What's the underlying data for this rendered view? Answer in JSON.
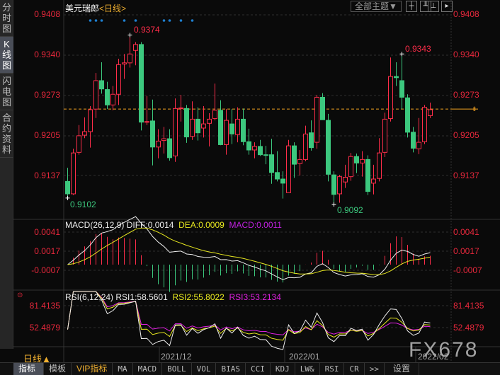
{
  "sidebar": {
    "tabs": [
      {
        "label": "分时图"
      },
      {
        "label": "K线图"
      },
      {
        "label": "闪电图"
      },
      {
        "label": "合约资料"
      }
    ]
  },
  "header": {
    "symbol": "美元瑞郎",
    "period_tag": "<日线>",
    "theme_button": "全部主题▼"
  },
  "main_axis": {
    "labels": [
      "0.9408",
      "0.9340",
      "0.9273",
      "0.9205",
      "0.9137"
    ],
    "high_label": "0.9374",
    "low_label": "0.9102",
    "high2_label": "0.9343",
    "low2_label": "0.9092",
    "current_price": 0.9249
  },
  "macd": {
    "title": "MACD(26,12,9)",
    "diff": "DIFF:0.0014",
    "dea": "DEA:0.0009",
    "macd": "MACD:0.0011",
    "axis": [
      "0.0041",
      "0.0017",
      "-0.0007"
    ]
  },
  "rsi": {
    "title": "RSI(6,12,24)",
    "rsi1": "RSI1:58.5601",
    "rsi2": "RSI2:55.8022",
    "rsi3": "RSI3:53.2134",
    "axis": [
      "81.4135",
      "52.4879"
    ]
  },
  "xaxis": {
    "period": "日线▲",
    "dates": [
      "2021/12",
      "2022/01",
      "2022/02"
    ]
  },
  "toolbar": [
    "指标",
    "模板",
    "VIP指标",
    "MA",
    "MACD",
    "BOLL",
    "VOL",
    "BIAS",
    "CCI",
    "KDJ",
    "LW&",
    "RSI",
    "CR",
    ">>",
    "设置"
  ],
  "watermark": "FX678",
  "colors": {
    "up": "#ff2d4a",
    "down": "#3cc87e",
    "axis": "#e8283c",
    "dea": "#e8e820",
    "rsi3": "#e020e0"
  },
  "chart_data": {
    "type": "candlestick",
    "ohlc": [
      [
        0.9127,
        0.915,
        0.9099,
        0.9106
      ],
      [
        0.9106,
        0.9182,
        0.9104,
        0.9175
      ],
      [
        0.9176,
        0.9222,
        0.9172,
        0.9204
      ],
      [
        0.9205,
        0.9235,
        0.92,
        0.9211
      ],
      [
        0.9211,
        0.9254,
        0.9184,
        0.9248
      ],
      [
        0.9249,
        0.931,
        0.9234,
        0.9297
      ],
      [
        0.9297,
        0.9328,
        0.9275,
        0.9283
      ],
      [
        0.9282,
        0.9295,
        0.9249,
        0.9256
      ],
      [
        0.9256,
        0.9288,
        0.9247,
        0.9274
      ],
      [
        0.9274,
        0.9334,
        0.9256,
        0.9324
      ],
      [
        0.9325,
        0.9342,
        0.93,
        0.9327
      ],
      [
        0.9327,
        0.9374,
        0.9319,
        0.9342
      ],
      [
        0.9348,
        0.9362,
        0.9323,
        0.9358
      ],
      [
        0.9358,
        0.9362,
        0.9213,
        0.9227
      ],
      [
        0.9227,
        0.9271,
        0.9222,
        0.9228
      ],
      [
        0.9229,
        0.9265,
        0.9154,
        0.9185
      ],
      [
        0.9185,
        0.9215,
        0.9166,
        0.9195
      ],
      [
        0.9196,
        0.9219,
        0.9174,
        0.9199
      ],
      [
        0.9199,
        0.9215,
        0.9162,
        0.9167
      ],
      [
        0.917,
        0.9267,
        0.916,
        0.925
      ],
      [
        0.925,
        0.9273,
        0.9228,
        0.9251
      ],
      [
        0.925,
        0.9256,
        0.9192,
        0.9202
      ],
      [
        0.9203,
        0.9262,
        0.9197,
        0.9232
      ],
      [
        0.9232,
        0.9252,
        0.9196,
        0.9209
      ],
      [
        0.9217,
        0.9254,
        0.9201,
        0.9224
      ],
      [
        0.9225,
        0.9242,
        0.9186,
        0.9232
      ],
      [
        0.9233,
        0.9292,
        0.923,
        0.9247
      ],
      [
        0.9247,
        0.9264,
        0.9188,
        0.9189
      ],
      [
        0.9189,
        0.9249,
        0.9172,
        0.923
      ],
      [
        0.9224,
        0.9249,
        0.919,
        0.9207
      ],
      [
        0.9206,
        0.9252,
        0.9193,
        0.9232
      ],
      [
        0.9232,
        0.925,
        0.9188,
        0.9194
      ],
      [
        0.9194,
        0.9216,
        0.9172,
        0.918
      ],
      [
        0.918,
        0.9193,
        0.9166,
        0.9186
      ],
      [
        0.9186,
        0.9197,
        0.917,
        0.9172
      ],
      [
        0.9172,
        0.9187,
        0.9156,
        0.9171
      ],
      [
        0.9172,
        0.9199,
        0.9123,
        0.9142
      ],
      [
        0.9142,
        0.9178,
        0.9127,
        0.9131
      ],
      [
        0.9131,
        0.9144,
        0.9098,
        0.9124
      ],
      [
        0.9108,
        0.9197,
        0.9108,
        0.9187
      ],
      [
        0.9187,
        0.9193,
        0.9133,
        0.9156
      ],
      [
        0.9157,
        0.918,
        0.9137,
        0.9164
      ],
      [
        0.9164,
        0.9221,
        0.9161,
        0.9207
      ],
      [
        0.9209,
        0.923,
        0.9179,
        0.9184
      ],
      [
        0.9193,
        0.9273,
        0.9182,
        0.9269
      ],
      [
        0.9269,
        0.9276,
        0.9231,
        0.9231
      ],
      [
        0.923,
        0.9241,
        0.9127,
        0.9139
      ],
      [
        0.9138,
        0.9144,
        0.9088,
        0.9105
      ],
      [
        0.9106,
        0.9138,
        0.9091,
        0.9135
      ],
      [
        0.9126,
        0.9155,
        0.9116,
        0.9134
      ],
      [
        0.9135,
        0.9175,
        0.9128,
        0.9169
      ],
      [
        0.9169,
        0.9174,
        0.9141,
        0.9158
      ],
      [
        0.9158,
        0.9178,
        0.9135,
        0.9164
      ],
      [
        0.9164,
        0.9171,
        0.9104,
        0.911
      ],
      [
        0.9124,
        0.9155,
        0.9105,
        0.9131
      ],
      [
        0.9132,
        0.92,
        0.9127,
        0.9175
      ],
      [
        0.9176,
        0.9243,
        0.9168,
        0.9232
      ],
      [
        0.9233,
        0.9336,
        0.9228,
        0.9304
      ],
      [
        0.9304,
        0.9328,
        0.9288,
        0.9302
      ],
      [
        0.9297,
        0.9342,
        0.9249,
        0.9269
      ],
      [
        0.9268,
        0.9274,
        0.9201,
        0.921
      ],
      [
        0.921,
        0.9219,
        0.9176,
        0.9183
      ],
      [
        0.9182,
        0.9234,
        0.9173,
        0.9193
      ],
      [
        0.9194,
        0.9256,
        0.919,
        0.9252
      ],
      [
        0.9238,
        0.926,
        0.9234,
        0.9248
      ]
    ],
    "ylim": [
      0.9082,
      0.9408
    ],
    "signal_marker_indices": [
      4,
      5,
      6,
      10,
      12,
      17,
      18,
      20,
      22
    ]
  }
}
